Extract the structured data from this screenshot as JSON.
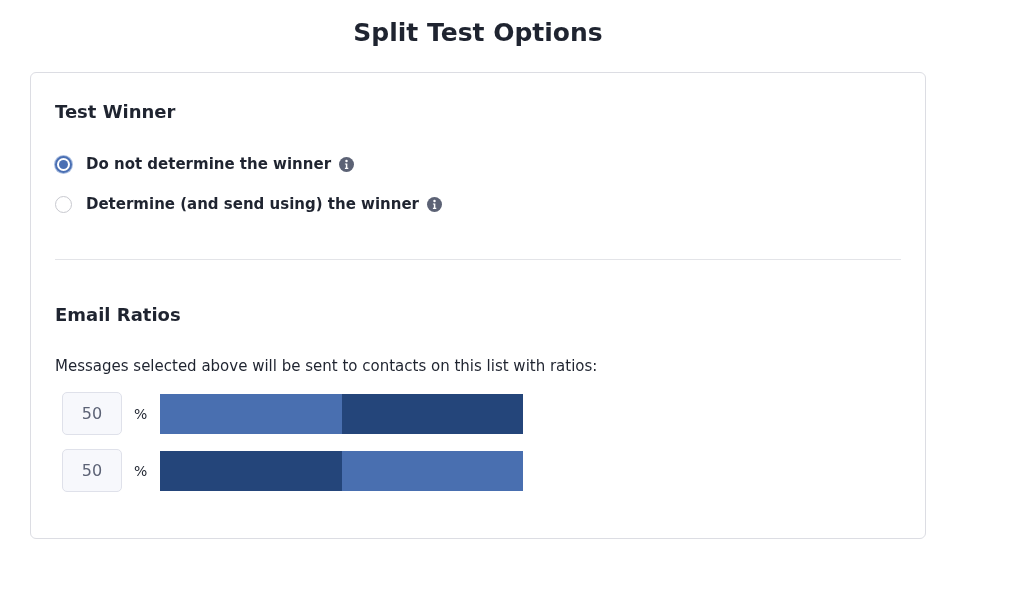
{
  "title": "Split Test Options",
  "test_winner": {
    "heading": "Test Winner",
    "options": [
      {
        "label": "Do not determine the winner",
        "selected": true
      },
      {
        "label": "Determine (and send using) the winner",
        "selected": false
      }
    ]
  },
  "email_ratios": {
    "heading": "Email Ratios",
    "description": "Messages selected above will be sent to contacts on this list with ratios:",
    "ratios": [
      {
        "value": "50",
        "unit": "%",
        "level": 0.5
      },
      {
        "value": "50",
        "unit": "%",
        "level": 0.5
      }
    ]
  }
}
